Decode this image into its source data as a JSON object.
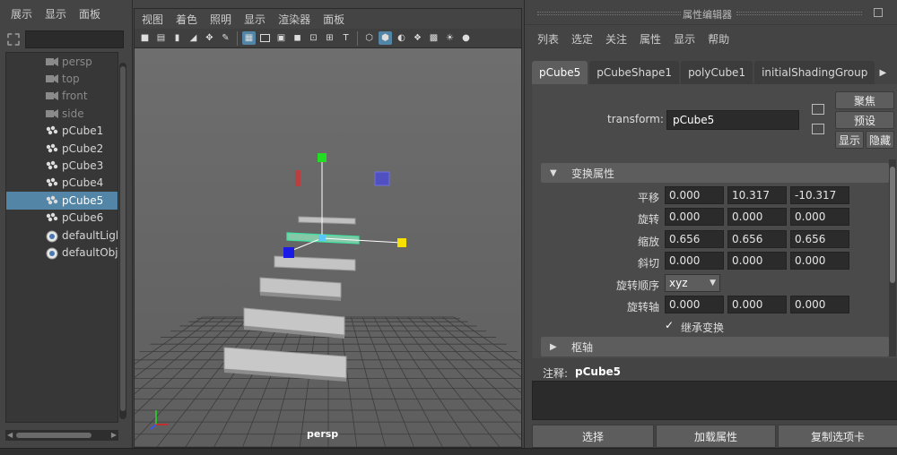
{
  "outliner": {
    "menu": [
      "展示",
      "显示",
      "面板"
    ],
    "search_placeholder": "",
    "nodes": [
      {
        "label": "persp",
        "icon": "camera-icon",
        "dim": true,
        "selected": false
      },
      {
        "label": "top",
        "icon": "camera-icon",
        "dim": true,
        "selected": false
      },
      {
        "label": "front",
        "icon": "camera-icon",
        "dim": true,
        "selected": false
      },
      {
        "label": "side",
        "icon": "camera-icon",
        "dim": true,
        "selected": false
      },
      {
        "label": "pCube1",
        "icon": "mesh-icon",
        "dim": false,
        "selected": false
      },
      {
        "label": "pCube2",
        "icon": "mesh-icon",
        "dim": false,
        "selected": false
      },
      {
        "label": "pCube3",
        "icon": "mesh-icon",
        "dim": false,
        "selected": false
      },
      {
        "label": "pCube4",
        "icon": "mesh-icon",
        "dim": false,
        "selected": false
      },
      {
        "label": "pCube5",
        "icon": "mesh-icon",
        "dim": false,
        "selected": true
      },
      {
        "label": "pCube6",
        "icon": "mesh-icon",
        "dim": false,
        "selected": false
      },
      {
        "label": "defaultLightSet",
        "icon": "set-icon",
        "dim": false,
        "selected": false
      },
      {
        "label": "defaultObjectSet",
        "icon": "set-icon",
        "dim": false,
        "selected": false
      }
    ]
  },
  "viewport": {
    "menu": [
      "视图",
      "着色",
      "照明",
      "显示",
      "渲染器",
      "面板"
    ],
    "camera_label": "persp"
  },
  "attribute_editor": {
    "title": "属性编辑器",
    "menu": [
      "列表",
      "选定",
      "关注",
      "属性",
      "显示",
      "帮助"
    ],
    "tabs": [
      "pCube5",
      "pCubeShape1",
      "polyCube1",
      "initialShadingGroup"
    ],
    "active_tab": "pCube5",
    "transform_label": "transform:",
    "transform_value": "pCube5",
    "buttons": {
      "focus": "聚焦",
      "presets": "预设",
      "show": "显示",
      "hide": "隐藏"
    },
    "section_transform": "变换属性",
    "rows": {
      "translate": {
        "label": "平移",
        "values": [
          "0.000",
          "10.317",
          "-10.317"
        ]
      },
      "rotate": {
        "label": "旋转",
        "values": [
          "0.000",
          "0.000",
          "0.000"
        ]
      },
      "scale": {
        "label": "缩放",
        "values": [
          "0.656",
          "0.656",
          "0.656"
        ]
      },
      "shear": {
        "label": "斜切",
        "values": [
          "0.000",
          "0.000",
          "0.000"
        ]
      },
      "rotate_order": {
        "label": "旋转顺序",
        "value": "xyz"
      },
      "rotate_axis": {
        "label": "旋转轴",
        "values": [
          "0.000",
          "0.000",
          "0.000"
        ]
      },
      "inherits": {
        "label": "继承变换",
        "checked": true,
        "mark": "✓"
      }
    },
    "section_pivots": "枢轴",
    "notes_label": "注释:",
    "notes_object": "pCube5",
    "bottom_buttons": [
      "选择",
      "加载属性",
      "复制选项卡"
    ]
  },
  "colors": {
    "selection": "#5285a6",
    "panel": "#444444",
    "viewport_bg": "#6a6a6a",
    "field_bg": "#2b2b2b"
  }
}
